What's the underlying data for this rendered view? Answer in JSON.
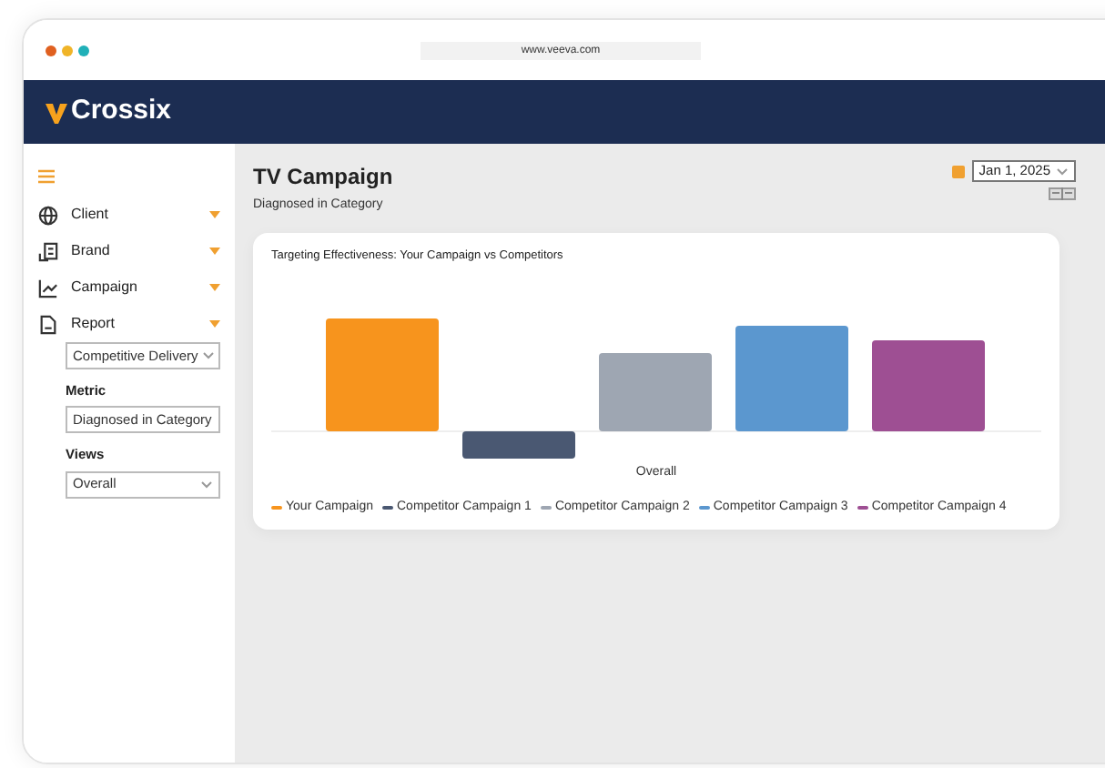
{
  "browser": {
    "url": "www.veeva.com"
  },
  "header": {
    "brand": "Crossix"
  },
  "sidebar": {
    "items": [
      {
        "label": "Client",
        "kind": "globe"
      },
      {
        "label": "Brand",
        "kind": "brand"
      },
      {
        "label": "Campaign",
        "kind": "chart"
      },
      {
        "label": "Report",
        "kind": "report"
      }
    ],
    "report_select": {
      "value": "Competitive Delivery"
    },
    "metric": {
      "label": "Metric",
      "value": "Diagnosed in Category"
    },
    "views": {
      "label": "Views",
      "value": "Overall"
    }
  },
  "page": {
    "title": "TV Campaign",
    "subtitle": "Diagnosed in Category",
    "date": "Jan 1, 2025"
  },
  "chart": {
    "title": "Targeting Effectiveness: Your Campaign vs Competitors",
    "category": "Overall",
    "legend": [
      {
        "label": "Your Campaign",
        "color": "#f7941d"
      },
      {
        "label": "Competitor Campaign 1",
        "color": "#4a5872"
      },
      {
        "label": "Competitor Campaign 2",
        "color": "#9ea6b2"
      },
      {
        "label": "Competitor Campaign 3",
        "color": "#5b97cf"
      },
      {
        "label": "Competitor Campaign 4",
        "color": "#9e4f93"
      }
    ]
  }
}
